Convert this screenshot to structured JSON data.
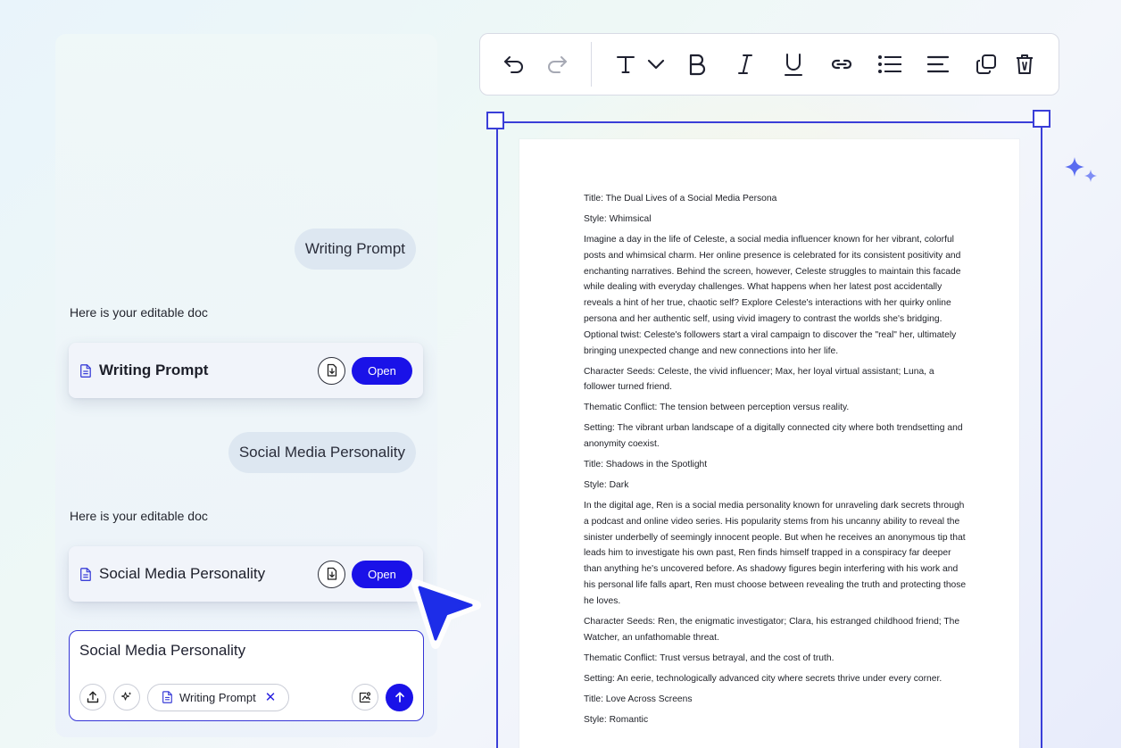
{
  "chat": {
    "messages": [
      {
        "role": "user",
        "text": "Writing Prompt"
      },
      {
        "role": "assistant",
        "text": "Here is your editable doc",
        "doc_title": "Writing Prompt",
        "open_label": "Open"
      },
      {
        "role": "user",
        "text": "Social Media Personality"
      },
      {
        "role": "assistant",
        "text": "Here is your editable doc",
        "doc_title": "Social Media Personality",
        "open_label": "Open"
      }
    ],
    "input": {
      "value": "Social Media Personality",
      "attachment_chip": "Writing Prompt"
    }
  },
  "toolbar": {
    "tools": [
      "undo-icon",
      "redo-icon",
      "text-style-icon",
      "chevron-down-icon",
      "bold-icon",
      "italic-icon",
      "underline-icon",
      "link-icon",
      "bullet-list-icon",
      "align-left-icon",
      "duplicate-icon",
      "delete-icon"
    ]
  },
  "document": {
    "paragraphs": [
      "Title: The Dual Lives of a Social Media Persona",
      "Style: Whimsical",
      "Imagine a day in the life of Celeste, a social media influencer known for her vibrant, colorful posts and whimsical charm. Her online presence is celebrated for its consistent positivity and enchanting narratives. Behind the screen, however, Celeste struggles to maintain this facade while dealing with everyday challenges. What happens when her latest post accidentally reveals a hint of her true, chaotic self? Explore Celeste's interactions with her quirky online persona and her authentic self, using vivid imagery to contrast the worlds she's bridging. Optional twist: Celeste's followers start a viral campaign to discover the \"real\" her, ultimately bringing unexpected change and new connections into her life.",
      "Character Seeds: Celeste, the vivid influencer; Max, her loyal virtual assistant; Luna, a follower turned friend.",
      "Thematic Conflict: The tension between perception versus reality.",
      "Setting: The vibrant urban landscape of a digitally connected city where both trendsetting and anonymity coexist.",
      "Title: Shadows in the Spotlight",
      "Style: Dark",
      "In the digital age, Ren is a social media personality known for unraveling dark secrets through a podcast and online video series. His popularity stems from his uncanny ability to reveal the sinister underbelly of seemingly innocent people. But when he receives an anonymous tip that leads him to investigate his own past, Ren finds himself trapped in a conspiracy far deeper than anything he's uncovered before. As shadowy figures begin interfering with his work and his personal life falls apart, Ren must choose between revealing the truth and protecting those he loves.",
      "Character Seeds: Ren, the enigmatic investigator; Clara, his estranged childhood friend; The Watcher, an unfathomable threat.",
      "Thematic Conflict: Trust versus betrayal, and the cost of truth.",
      "Setting: An eerie, technologically advanced city where secrets thrive under every corner.",
      "Title: Love Across Screens",
      "Style: Romantic"
    ]
  },
  "colors": {
    "accent": "#1a12e8",
    "selection": "#3a3ed8",
    "bubble": "#dde7f1",
    "sparkle": "#5a6cf0"
  }
}
